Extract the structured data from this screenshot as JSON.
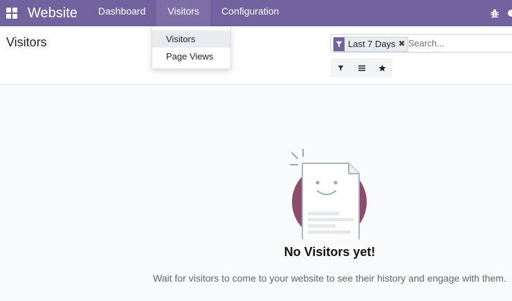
{
  "navbar": {
    "brand": "Website",
    "menus": [
      {
        "label": "Dashboard"
      },
      {
        "label": "Visitors"
      },
      {
        "label": "Configuration"
      }
    ],
    "color": "#71639e"
  },
  "dropdown": {
    "items": [
      {
        "label": "Visitors"
      },
      {
        "label": "Page Views"
      }
    ]
  },
  "control_panel": {
    "title": "Visitors"
  },
  "search": {
    "facet": "Last 7 Days",
    "placeholder": "Search..."
  },
  "empty_state": {
    "title": "No Visitors yet!",
    "text": "Wait for visitors to come to your website to see their history and engage with them."
  }
}
